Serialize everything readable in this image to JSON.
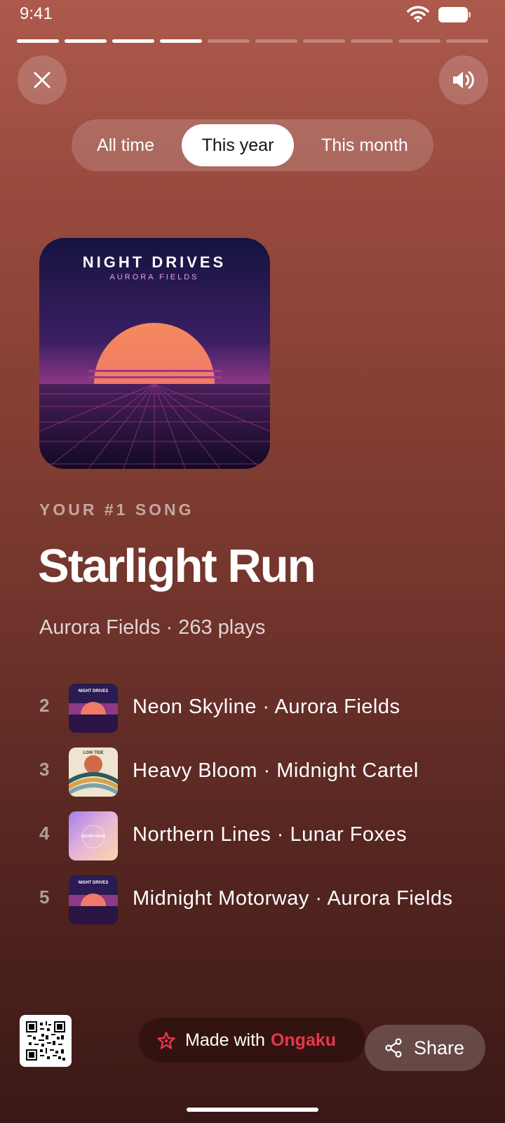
{
  "status_bar": {
    "time": "9:41"
  },
  "story_progress": {
    "total_segments": 10,
    "completed_segments": 4
  },
  "period_tabs": [
    {
      "label": "All time",
      "active": false
    },
    {
      "label": "This year",
      "active": true
    },
    {
      "label": "This month",
      "active": false
    }
  ],
  "cover": {
    "title": "NIGHT DRIVES",
    "artist": "AURORA FIELDS"
  },
  "top_song": {
    "eyebrow": "YOUR #1 SONG",
    "title": "Starlight Run",
    "meta": "Aurora Fields · 263 plays"
  },
  "ranking": [
    {
      "rank": "2",
      "label": "Neon Skyline · Aurora Fields",
      "thumb": "night-drives"
    },
    {
      "rank": "3",
      "label": "Heavy Bloom · Midnight Cartel",
      "thumb": "low-tide"
    },
    {
      "rank": "4",
      "label": "Northern Lines · Lunar Foxes",
      "thumb": "silver-hour"
    },
    {
      "rank": "5",
      "label": "Midnight Motorway · Aurora Fields",
      "thumb": "night-drives"
    }
  ],
  "thumb_text": {
    "night_drives": "NIGHT DRIVES",
    "low_tide": "LOW TIDE",
    "silver_hour": "SILVER HOUR"
  },
  "footer": {
    "made_with": "Made with",
    "brand": "Ongaku",
    "share_label": "Share"
  },
  "colors": {
    "brand_red": "#e8374a",
    "background_top": "#ad5a4d",
    "background_bottom": "#3a1816"
  }
}
